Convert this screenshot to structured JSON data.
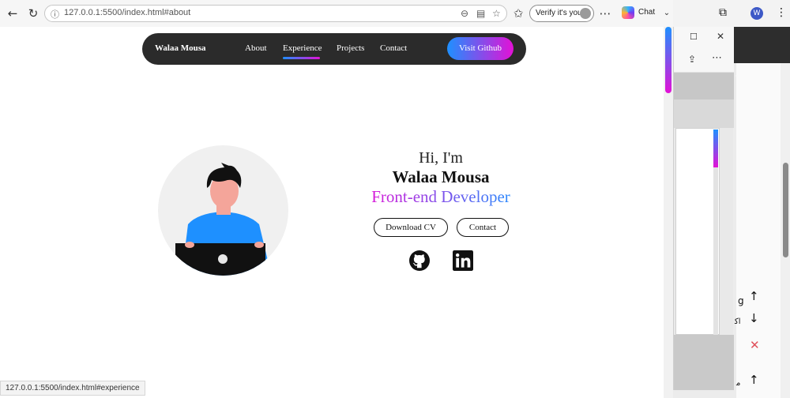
{
  "browser": {
    "url": "127.0.0.1:5500/index.html#about",
    "verify_label": "Verify it's you",
    "chat_label": "Chat",
    "status_url": "127.0.0.1:5500/index.html#experience"
  },
  "site": {
    "brand": "Walaa Mousa",
    "nav": [
      "About",
      "Experience",
      "Projects",
      "Contact"
    ],
    "active_nav": "Experience",
    "github_label": "Visit Github"
  },
  "hero": {
    "greeting": "Hi, I'm",
    "name": "Walaa Mousa",
    "role": "Front-end Developer",
    "download_label": "Download CV",
    "contact_label": "Contact"
  },
  "background_window": {
    "partial_text_1": "g",
    "partial_text_2": "ﺍﻛ",
    "partial_text_3": "ﻣ"
  },
  "colors": {
    "accent_start": "#1e90ff",
    "accent_end": "#e311d6",
    "nav_bg": "#2b2b2b"
  }
}
